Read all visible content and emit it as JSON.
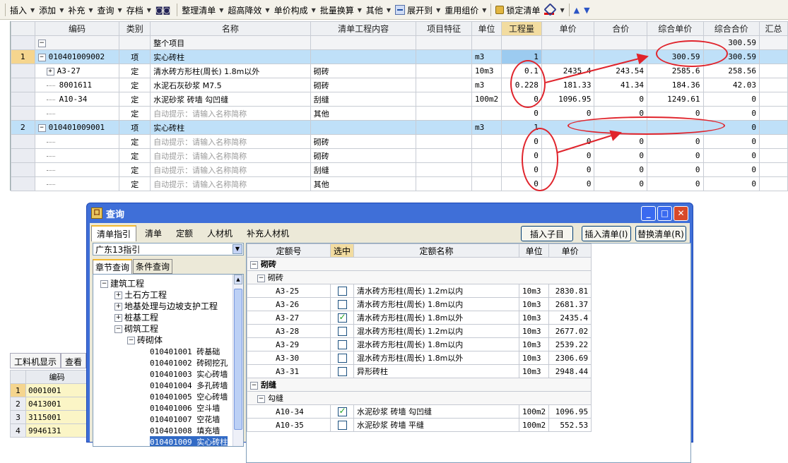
{
  "toolbar": {
    "items": [
      {
        "label": "插入",
        "arrow": true
      },
      {
        "label": "添加",
        "arrow": true
      },
      {
        "label": "补充",
        "arrow": true
      },
      {
        "label": "查询",
        "arrow": true
      },
      {
        "label": "存档",
        "arrow": true
      },
      {
        "label": "整理清单",
        "arrow": true
      },
      {
        "label": "超高降效",
        "arrow": true
      },
      {
        "label": "单价构成",
        "arrow": true
      },
      {
        "label": "批量换算",
        "arrow": true
      },
      {
        "label": "其他",
        "arrow": true
      },
      {
        "label": "展开到",
        "arrow": true
      },
      {
        "label": "重用组价",
        "arrow": true
      },
      {
        "label": "锁定清单",
        "arrow": false
      }
    ]
  },
  "main_grid": {
    "headers": [
      "编码",
      "类别",
      "名称",
      "清单工程内容",
      "项目特征",
      "单位",
      "工程量",
      "单价",
      "合价",
      "综合单价",
      "综合合价",
      "汇总"
    ],
    "total_label": "整个项目",
    "total_value": "300.59",
    "rows": [
      {
        "no": "1",
        "code": "010401009002",
        "type": "项",
        "name": "实心砖柱",
        "content": "",
        "unit": "m3",
        "qty": "1",
        "price": "",
        "amount": "",
        "comp_price": "300.59",
        "comp_total": "300.59"
      },
      {
        "no": "",
        "code": "A3-27",
        "type": "定",
        "name": "清水砖方形柱(周长) 1.8m以外",
        "content": "砌砖",
        "unit": "10m3",
        "qty": "0.1",
        "price": "2435.4",
        "amount": "243.54",
        "comp_price": "2585.6",
        "comp_total": "258.56"
      },
      {
        "no": "",
        "code": "8001611",
        "type": "定",
        "name": "水泥石灰砂浆 M7.5",
        "content": "砌砖",
        "unit": "m3",
        "qty": "0.228",
        "price": "181.33",
        "amount": "41.34",
        "comp_price": "184.36",
        "comp_total": "42.03"
      },
      {
        "no": "",
        "code": "A10-34",
        "type": "定",
        "name": "水泥砂浆 砖墙 勾凹缝",
        "content": "刮缝",
        "unit": "100m2",
        "qty": "0",
        "price": "1096.95",
        "amount": "0",
        "comp_price": "1249.61",
        "comp_total": "0"
      },
      {
        "no": "",
        "code": "",
        "type": "定",
        "name": "自动提示：请输入名称简称",
        "content": "其他",
        "unit": "",
        "qty": "0",
        "price": "0",
        "amount": "0",
        "comp_price": "0",
        "comp_total": "0"
      },
      {
        "no": "2",
        "code": "010401009001",
        "type": "项",
        "name": "实心砖柱",
        "content": "",
        "unit": "m3",
        "qty": "1",
        "price": "",
        "amount": "",
        "comp_price": "",
        "comp_total": "0"
      },
      {
        "no": "",
        "code": "",
        "type": "定",
        "name": "自动提示：请输入名称简称",
        "content": "砌砖",
        "unit": "",
        "qty": "0",
        "price": "0",
        "amount": "0",
        "comp_price": "0",
        "comp_total": "0"
      },
      {
        "no": "",
        "code": "",
        "type": "定",
        "name": "自动提示：请输入名称简称",
        "content": "砌砖",
        "unit": "",
        "qty": "0",
        "price": "0",
        "amount": "0",
        "comp_price": "0",
        "comp_total": "0"
      },
      {
        "no": "",
        "code": "",
        "type": "定",
        "name": "自动提示：请输入名称简称",
        "content": "刮缝",
        "unit": "",
        "qty": "0",
        "price": "0",
        "amount": "0",
        "comp_price": "0",
        "comp_total": "0"
      },
      {
        "no": "",
        "code": "",
        "type": "定",
        "name": "自动提示：请输入名称简称",
        "content": "其他",
        "unit": "",
        "qty": "0",
        "price": "0",
        "amount": "0",
        "comp_price": "0",
        "comp_total": "0"
      }
    ]
  },
  "lower_panel": {
    "tabs": [
      "工料机显示",
      "查看"
    ],
    "header": "编码",
    "rows": [
      {
        "no": "1",
        "code": "0001001"
      },
      {
        "no": "2",
        "code": "0413001"
      },
      {
        "no": "3",
        "code": "3115001"
      },
      {
        "no": "4",
        "code": "9946131"
      }
    ]
  },
  "dialog": {
    "title": "查询",
    "tabs": [
      "清单指引",
      "清单",
      "定额",
      "人材机",
      "补充人材机"
    ],
    "buttons": {
      "insert_child": "插入子目",
      "insert_list": "插入清单(I)",
      "replace_list": "替换清单(R)"
    },
    "region": "广东13指引",
    "subtabs": [
      "章节查询",
      "条件查询"
    ],
    "tree": [
      {
        "label": "建筑工程",
        "level": 0,
        "toggle": "−"
      },
      {
        "label": "土石方工程",
        "level": 1,
        "toggle": "+"
      },
      {
        "label": "地基处理与边坡支护工程",
        "level": 1,
        "toggle": "+"
      },
      {
        "label": "桩基工程",
        "level": 1,
        "toggle": "+"
      },
      {
        "label": "砌筑工程",
        "level": 1,
        "toggle": "−"
      },
      {
        "label": "砖砌体",
        "level": 2,
        "toggle": "−"
      },
      {
        "label": "010401001  砖基础",
        "level": 3
      },
      {
        "label": "010401002  砖砌挖孔",
        "level": 3
      },
      {
        "label": "010401003  实心砖墙",
        "level": 3
      },
      {
        "label": "010401004  多孔砖墙",
        "level": 3
      },
      {
        "label": "010401005  空心砖墙",
        "level": 3
      },
      {
        "label": "010401006  空斗墙",
        "level": 3
      },
      {
        "label": "010401007  空花墙",
        "level": 3
      },
      {
        "label": "010401008  填充墙",
        "level": 3
      },
      {
        "label": "010401009  实心砖柱",
        "level": 3,
        "selected": true
      }
    ],
    "grid_headers": [
      "定额号",
      "选中",
      "定额名称",
      "单位",
      "单价"
    ],
    "groups": [
      {
        "name": "砌砖",
        "sub": "砌砖",
        "items": [
          {
            "code": "A3-25",
            "checked": false,
            "name": "清水砖方形柱(周长) 1.2m以内",
            "unit": "10m3",
            "price": "2830.81"
          },
          {
            "code": "A3-26",
            "checked": false,
            "name": "清水砖方形柱(周长) 1.8m以内",
            "unit": "10m3",
            "price": "2681.37"
          },
          {
            "code": "A3-27",
            "checked": true,
            "name": "清水砖方形柱(周长) 1.8m以外",
            "unit": "10m3",
            "price": "2435.4"
          },
          {
            "code": "A3-28",
            "checked": false,
            "name": "混水砖方形柱(周长) 1.2m以内",
            "unit": "10m3",
            "price": "2677.02"
          },
          {
            "code": "A3-29",
            "checked": false,
            "name": "混水砖方形柱(周长) 1.8m以内",
            "unit": "10m3",
            "price": "2539.22"
          },
          {
            "code": "A3-30",
            "checked": false,
            "name": "混水砖方形柱(周长) 1.8m以外",
            "unit": "10m3",
            "price": "2306.69"
          },
          {
            "code": "A3-31",
            "checked": false,
            "name": "异形砖柱",
            "unit": "10m3",
            "price": "2948.44"
          }
        ]
      },
      {
        "name": "刮缝",
        "sub": "勾缝",
        "items": [
          {
            "code": "A10-34",
            "checked": true,
            "name": "水泥砂浆 砖墙 勾凹缝",
            "unit": "100m2",
            "price": "1096.95"
          },
          {
            "code": "A10-35",
            "checked": false,
            "name": "水泥砂浆 砖墙 平缝",
            "unit": "100m2",
            "price": "552.53"
          }
        ]
      }
    ]
  },
  "colors": {
    "annotation": "#e0242c",
    "selected_row": "#bfe0f8",
    "highlight_header": "#f2dca0",
    "title_bar": "#3f6fd8"
  }
}
